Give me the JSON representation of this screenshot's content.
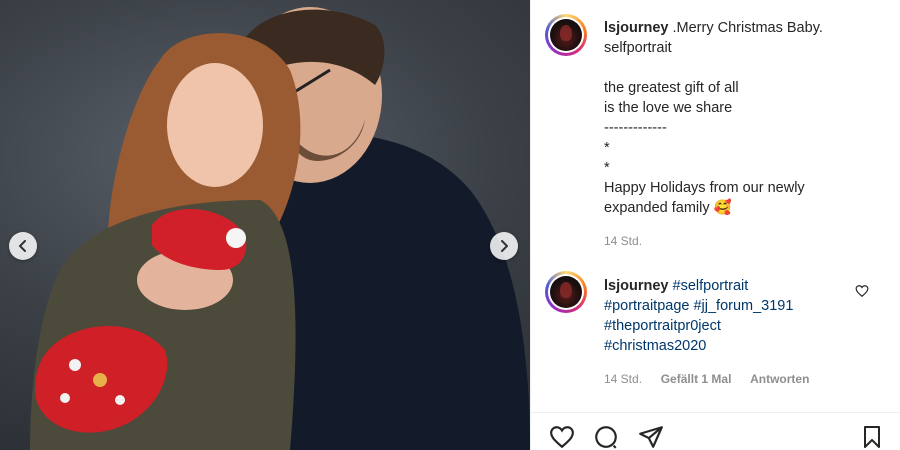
{
  "post": {
    "username": "lsjourney",
    "caption_first": " .Merry Christmas Baby.",
    "caption_lines": [
      "selfportrait",
      "",
      "the greatest gift of all",
      "is the love we share",
      "-------------",
      "*",
      "*",
      "Happy Holidays from our newly",
      "expanded family"
    ],
    "emoji": "🥰",
    "time": "14 Std."
  },
  "comment": {
    "username": "lsjourney",
    "tags": [
      "#selfportrait",
      "#portraitpage #jj_forum_3191",
      "#theportraitpr0ject",
      "#christmas2020"
    ],
    "time": "14 Std.",
    "likes": "Gefällt 1 Mal",
    "reply": "Antworten"
  },
  "icons": {
    "prev": "chevron-left-icon",
    "next": "chevron-right-icon",
    "like": "heart-icon",
    "comment": "comment-icon",
    "share": "paper-plane-icon",
    "save": "bookmark-icon"
  }
}
